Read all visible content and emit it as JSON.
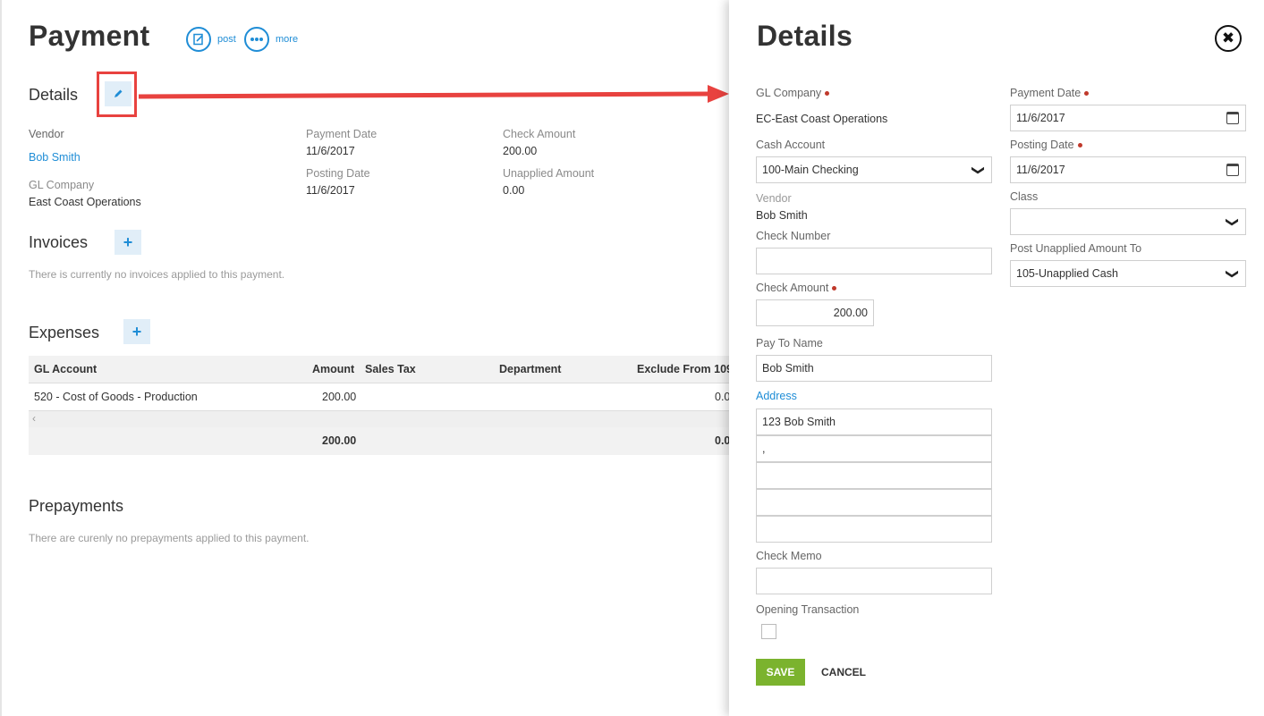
{
  "page": {
    "title": "Payment",
    "post_label": "post",
    "more_label": "more"
  },
  "details": {
    "title": "Details",
    "vendor_label": "Vendor",
    "vendor_value": "Bob Smith",
    "gl_company_label": "GL Company",
    "gl_company_value": "East Coast Operations",
    "payment_date_label": "Payment Date",
    "payment_date_value": "11/6/2017",
    "posting_date_label": "Posting Date",
    "posting_date_value": "11/6/2017",
    "check_amount_label": "Check Amount",
    "check_amount_value": "200.00",
    "unapplied_label": "Unapplied Amount",
    "unapplied_value": "0.00"
  },
  "invoices": {
    "title": "Invoices",
    "empty": "There is currently no invoices applied to this payment."
  },
  "expenses": {
    "title": "Expenses",
    "columns": [
      "GL Account",
      "Amount",
      "Sales Tax",
      "Department",
      "Exclude From 109"
    ],
    "row": {
      "gl_account": "520 - Cost of Goods - Production",
      "amount": "200.00",
      "exclude": "0.0"
    },
    "footer": {
      "amount": "200.00",
      "exclude": "0.0"
    }
  },
  "prepayments": {
    "title": "Prepayments",
    "empty": "There are curenly no prepayments applied to this payment."
  },
  "panel": {
    "title": "Details",
    "gl_company_label": "GL Company",
    "gl_company_value": "EC-East Coast Operations",
    "cash_account_label": "Cash Account",
    "cash_account_value": "100-Main Checking",
    "vendor_label": "Vendor",
    "vendor_value": "Bob Smith",
    "check_number_label": "Check Number",
    "check_number_value": "",
    "check_amount_label": "Check Amount",
    "check_amount_value": "200.00",
    "pay_to_label": "Pay To Name",
    "pay_to_value": "Bob Smith",
    "address_label": "Address",
    "address_lines": [
      "123 Bob Smith",
      ",",
      "",
      "",
      ""
    ],
    "check_memo_label": "Check Memo",
    "check_memo_value": "",
    "opening_label": "Opening Transaction",
    "payment_date_label": "Payment Date",
    "payment_date_value": "11/6/2017",
    "posting_date_label": "Posting Date",
    "posting_date_value": "11/6/2017",
    "class_label": "Class",
    "class_value": "",
    "post_unapplied_label": "Post Unapplied Amount To",
    "post_unapplied_value": "105-Unapplied Cash",
    "save_label": "SAVE",
    "cancel_label": "CANCEL"
  },
  "colors": {
    "accent": "#1f8dd6",
    "required": "#c0392b",
    "save": "#7bb32e",
    "annotation": "#e8423f"
  }
}
